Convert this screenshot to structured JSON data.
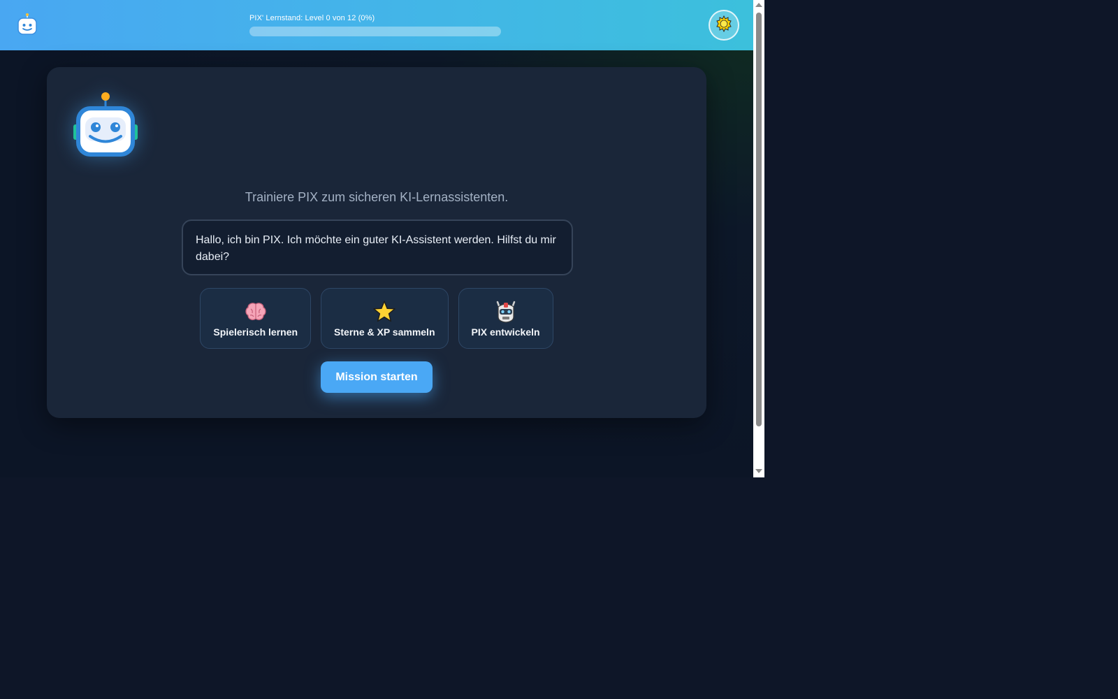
{
  "header": {
    "logo_icon": "robot-face-icon",
    "progress_label": "PIX' Lernstand: Level 0 von 12 (0%)",
    "progress_fraction": 0,
    "theme_icon": "sun-icon"
  },
  "main": {
    "mascot_icon": "robot-mascot-icon",
    "subtitle": "Trainiere PIX zum sicheren KI-Lernassistenten.",
    "speech": "Hallo, ich bin PIX. Ich möchte ein guter KI-Assistent werden. Hilfst du mir dabei?",
    "features": [
      {
        "icon": "brain-icon",
        "label": "Spielerisch lernen"
      },
      {
        "icon": "star-icon",
        "label": "Sterne & XP sammeln"
      },
      {
        "icon": "robot-icon",
        "label": "PIX entwickeln"
      }
    ],
    "cta_label": "Mission starten"
  },
  "colors": {
    "accent": "#4aa8f5",
    "header_start": "#49a7f2",
    "header_end": "#3cc0dc",
    "card": "#1a2639",
    "background": "#0e1628"
  }
}
